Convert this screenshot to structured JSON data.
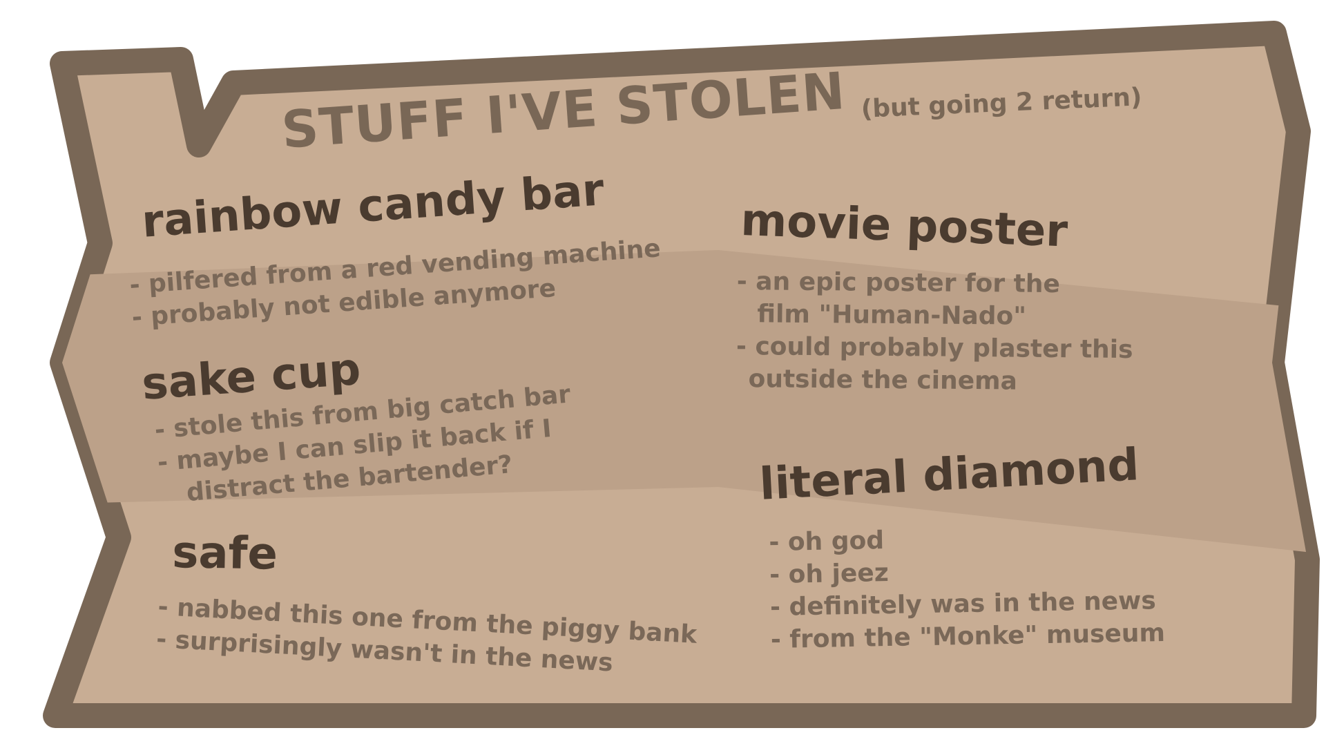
{
  "title": "STUFF I'VE STOLEN",
  "subtitle": "(but going 2 return)",
  "items": [
    {
      "heading": "rainbow candy bar",
      "notes": [
        "- pilfered from a red vending machine",
        "- probably not edible anymore"
      ]
    },
    {
      "heading": "sake cup",
      "notes": [
        "- stole this from big catch bar",
        "- maybe I can slip it back if I",
        "distract the bartender?"
      ]
    },
    {
      "heading": "safe",
      "notes": [
        "- nabbed this one from the piggy bank",
        "- surprisingly wasn't in the news"
      ]
    },
    {
      "heading": "movie poster",
      "notes": [
        "- an epic poster for the",
        "film \"Human-Nado\"",
        "- could probably plaster this",
        "outside the cinema"
      ]
    },
    {
      "heading": "literal diamond",
      "notes": [
        "- oh god",
        "- oh jeez",
        "- definitely was in the news",
        "- from the \"Monke\" museum"
      ]
    }
  ],
  "colors": {
    "board_border": "#796756",
    "board_fill": "#c8ad94",
    "board_band": "#bca189",
    "heading_text": "#4a3b2f",
    "note_text": "#7a6858"
  }
}
